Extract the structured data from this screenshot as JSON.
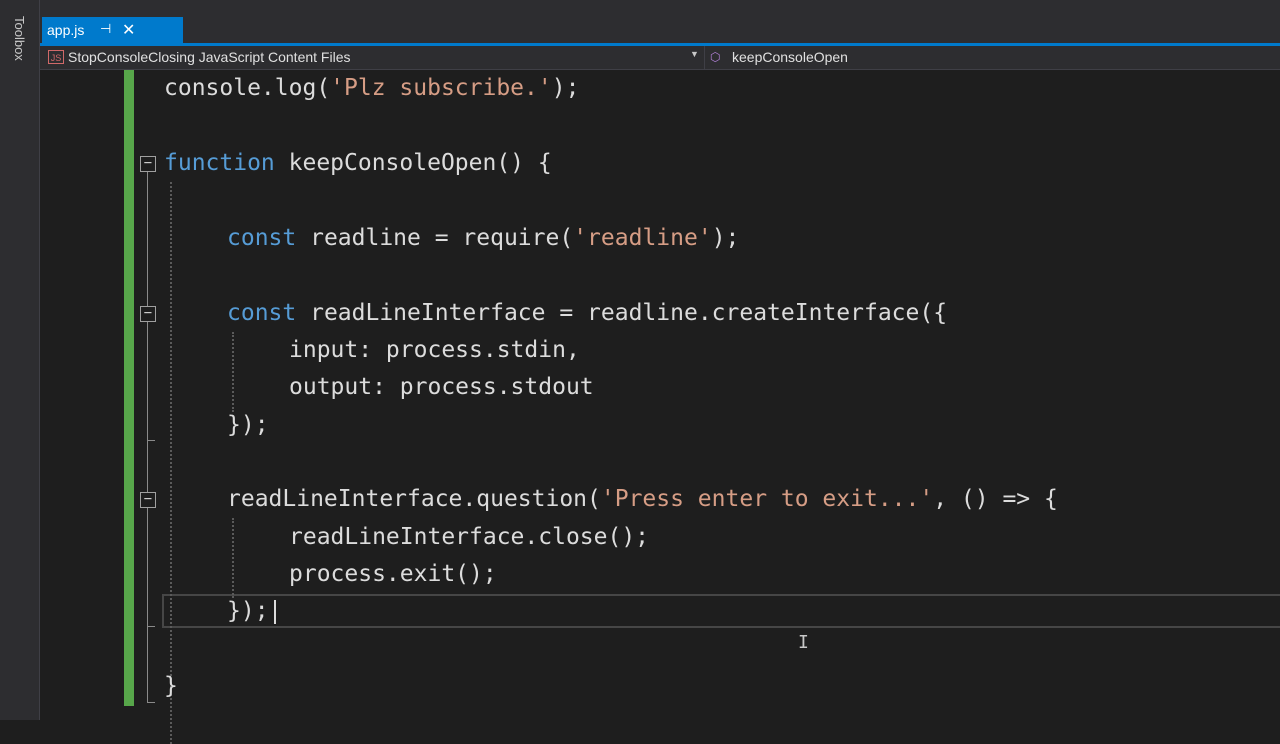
{
  "toolbox": {
    "label": "Toolbox"
  },
  "tab": {
    "title": "app.js",
    "pin": "⊣",
    "close": "✕"
  },
  "navbar": {
    "project": "StopConsoleClosing JavaScript Content Files",
    "member": "keepConsoleOpen",
    "dropdown_glyph": "▼",
    "project_icon": "js-file-icon",
    "member_icon": "cube-icon"
  },
  "code": {
    "l1_a": "console.log(",
    "l1_str": "'Plz subscribe.'",
    "l1_b": ");",
    "l2_kw": "function",
    "l2_rest": " keepConsoleOpen() {",
    "l3_kw": "const",
    "l3_a": " readline = require(",
    "l3_str": "'readline'",
    "l3_b": ");",
    "l4_kw": "const",
    "l4_rest": " readLineInterface = readline.createInterface({",
    "l5": "input: process.stdin,",
    "l6": "output: process.stdout",
    "l7": "});",
    "l8_a": "readLineInterface.question(",
    "l8_str": "'Press enter to exit...'",
    "l8_b": ", () => {",
    "l9": "readLineInterface.close();",
    "l10": "process.exit();",
    "l11": "});",
    "l12": "}"
  },
  "colors": {
    "keyword": "#569cd6",
    "string": "#d69d85",
    "text": "#dcdcdc",
    "accent": "#007acc",
    "change_margin": "#57a64a"
  }
}
